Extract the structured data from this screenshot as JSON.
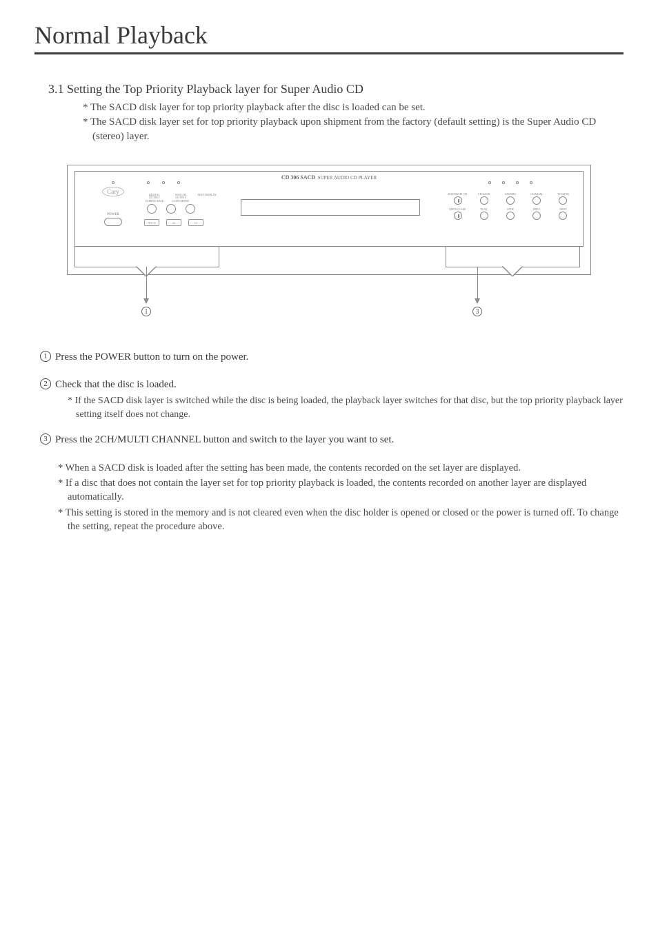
{
  "page_title": "Normal Playback",
  "section": {
    "number": "3.1",
    "heading": "Setting the Top Priority Playback layer for Super Audio CD",
    "intro_notes": [
      "* The SACD disk layer for top priority playback after the disc is loaded can be set.",
      "* The SACD disk layer set for top priority playback upon shipment from the factory (default setting) is the Super Audio CD (stereo) layer."
    ]
  },
  "device": {
    "title_main": "CD 306 SACD",
    "title_sub": "SUPER AUDIO CD PLAYER",
    "logo_text": "Cary",
    "power_label": "POWER",
    "mid_labels": [
      "DIGITAL OUTPUT SAMPLE RATE",
      "ANALOG OUTPUT CONVERTER",
      "TEXT DISPLAY"
    ],
    "logo_boxes": [
      "HDCD",
      "dts",
      "SA"
    ],
    "right_top_labels": [
      "2CH/MULTI CH",
      "CD/SACD",
      "AES/EBU",
      "COAXIAL",
      "TOSLINK"
    ],
    "right_bottom_labels": [
      "OPEN/CLOSE",
      "PLAY",
      "STOP",
      "PREV.",
      "NEXT"
    ]
  },
  "callouts": {
    "c1": "1",
    "c3": "3"
  },
  "steps": [
    {
      "num": "1",
      "text": "Press the POWER button to turn on the power.",
      "notes": []
    },
    {
      "num": "2",
      "text": "Check that the disc is loaded.",
      "notes": [
        "* If the SACD disk layer is switched while the disc is being loaded, the playback layer switches for that disc, but the top priority playback layer setting itself does not change."
      ]
    },
    {
      "num": "3",
      "text": "Press the 2CH/MULTI CHANNEL button and switch to the layer you want to set.",
      "notes": []
    }
  ],
  "bottom_notes": [
    "* When a  SACD disk is loaded after the setting has been made, the contents recorded on the set  layer are displayed.",
    "* If a disc that does not contain the layer set for top priority playback is loaded, the contents recorded on another layer are displayed automatically.",
    "* This setting is stored in the memory and is not cleared even when the disc holder is opened or closed or the power is turned off. To change the setting, repeat the procedure above."
  ]
}
